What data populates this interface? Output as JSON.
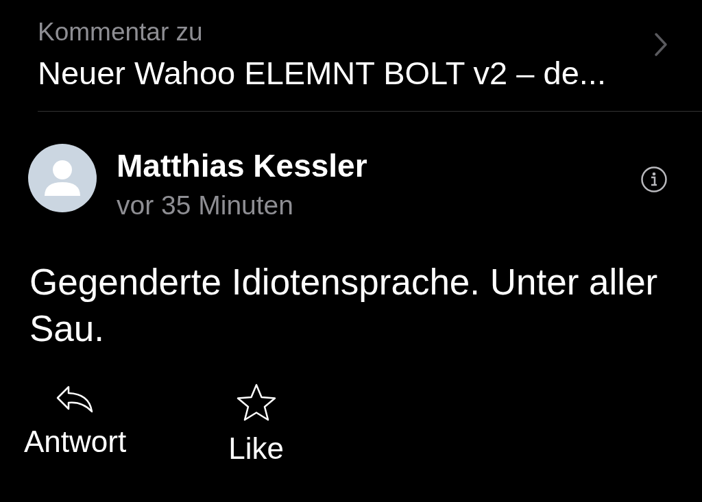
{
  "header": {
    "label": "Kommentar zu",
    "title": "Neuer Wahoo ELEMNT BOLT v2 – de..."
  },
  "comment": {
    "author": "Matthias Kessler",
    "time": "vor 35 Minuten",
    "text": "Gegenderte Idiotensprache. Unter aller Sau."
  },
  "actions": [
    {
      "kind": "reply",
      "label": "Antwort"
    },
    {
      "kind": "like",
      "label": "Like"
    }
  ]
}
